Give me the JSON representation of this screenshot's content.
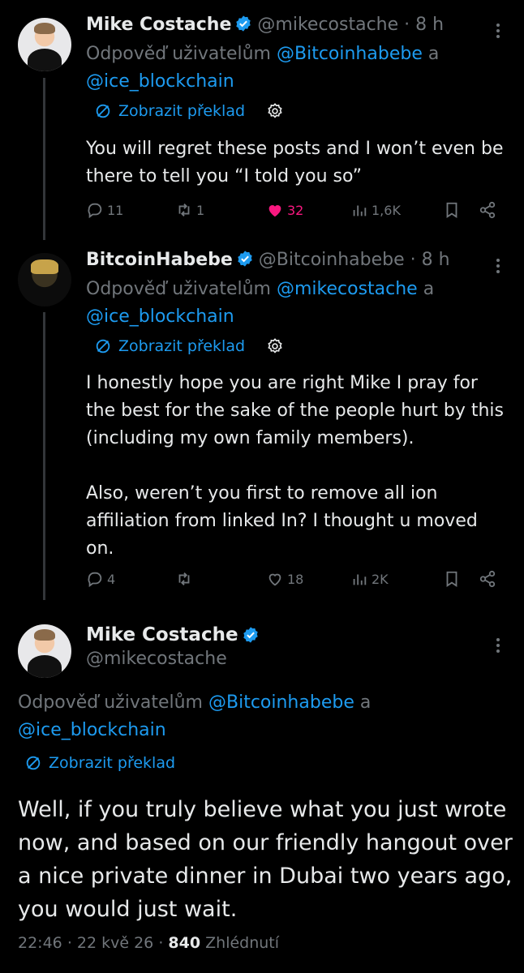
{
  "tweet1": {
    "name": "Mike Costache",
    "handle": "@mikecostache",
    "sep": "·",
    "time": "8 h",
    "reply_prefix": "Odpověď uživatelům",
    "reply_user1": "@Bitcoinhabebe",
    "reply_and": "a",
    "reply_user2": "@ice_blockchain",
    "translate": "Zobrazit překlad",
    "text": "You will regret these posts and I won’t even be there to tell you “I told you so”",
    "replies": "11",
    "retweets": "1",
    "likes": "32",
    "views": "1,6K"
  },
  "tweet2": {
    "name": "BitcoinHabebe",
    "handle": "@Bitcoinhabebe",
    "sep": "·",
    "time": "8 h",
    "reply_prefix": "Odpověď uživatelům",
    "reply_user1": "@mikecostache",
    "reply_and": "a",
    "reply_user2": "@ice_blockchain",
    "translate": "Zobrazit překlad",
    "text_p1": "I honestly hope you are right Mike I pray for the best for the sake of the people hurt by this (including my own family members).",
    "text_p2": "Also, weren’t you first to remove all ion affiliation from linked In? I thought u moved on.",
    "replies": "4",
    "retweets": "",
    "likes": "18",
    "views": "2K"
  },
  "main": {
    "name": "Mike Costache",
    "handle": "@mikecostache",
    "reply_prefix": "Odpověď uživatelům",
    "reply_user1": "@Bitcoinhabebe",
    "reply_and": "a",
    "reply_user2": "@ice_blockchain",
    "translate": "Zobrazit překlad",
    "text": "Well, if you truly believe what you just wrote now, and based on our friendly hangout over a nice private dinner in Dubai two years ago, you would just wait.",
    "time": "22:46",
    "sep": "·",
    "date": "22 kvě 26",
    "views_count": "840",
    "views_label": "Zhlédnutí"
  },
  "colors": {
    "accent": "#1d9bf0",
    "like": "#f91880",
    "muted": "#71767b",
    "text": "#e7e9ea",
    "bg": "#000000"
  },
  "icons": [
    "verified-badge-icon",
    "more-icon",
    "translate-icon",
    "gear-icon",
    "reply-icon",
    "retweet-icon",
    "like-icon",
    "views-icon",
    "bookmark-icon",
    "share-icon"
  ]
}
